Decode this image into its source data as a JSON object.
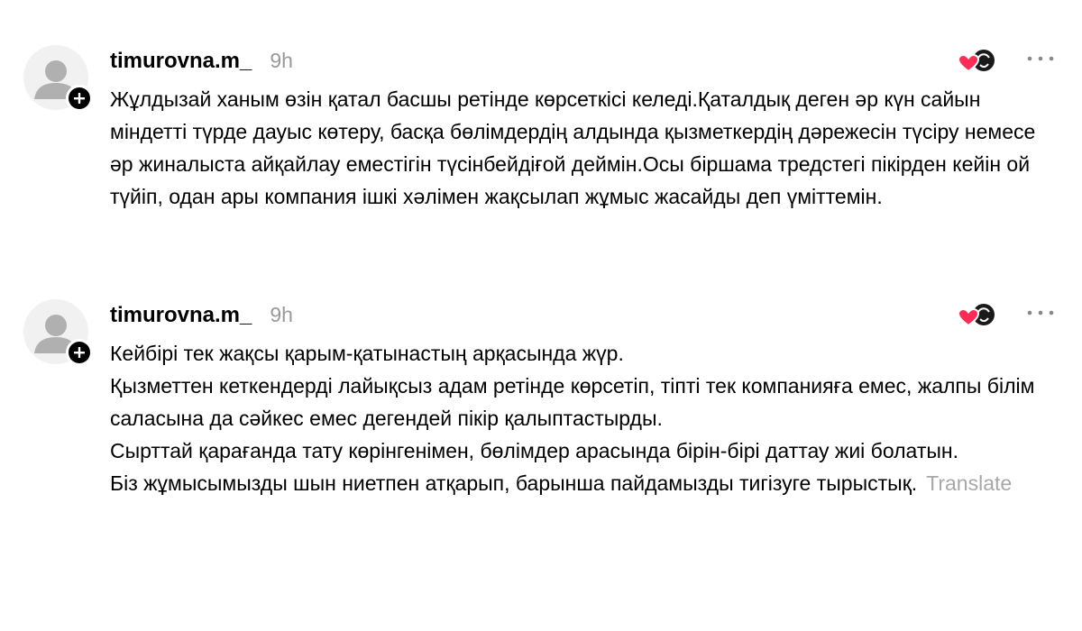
{
  "posts": [
    {
      "username": "timurovna.m_",
      "time": "9h",
      "paragraphs": [
        "Жұлдызай ханым өзін қатал басшы ретінде көрсеткісі келеді.Қаталдық деген әр күн сайын міндетті түрде дауыс көтеру, басқа бөлімдердің алдында қызметкердің дәрежесін түсіру немесе әр жиналыста айқайлау еместігін түсінбейдіғой деймін.Осы біршама тредстегі пікірден кейін ой түйіп, одан ары компания ішкі хәлімен жақсылап жұмыс жасайды деп үміттемін."
      ]
    },
    {
      "username": "timurovna.m_",
      "time": "9h",
      "paragraphs": [
        "Кейбірі тек жақсы қарым-қатынастың арқасында жүр.",
        "Қызметтен кеткендерді лайықсыз адам ретінде көрсетіп, тіпті тек компанияға емес, жалпы білім саласына да сәйкес емес дегендей пікір қалыптастырды.",
        "Сырттай қарағанда тату көрінгенімен, бөлімдер арасында бірін-бірі даттау жиі болатын.",
        "Біз жұмысымызды шын ниетпен атқарып, барынша пайдамызды тигізуге тырыстық."
      ],
      "translate_label": "Translate"
    }
  ],
  "icons": {
    "avatar": "default-avatar-icon",
    "follow": "plus-icon",
    "reactions": "reaction-emojis-icon",
    "more": "more-horizontal-icon"
  },
  "colors": {
    "text": "#000000",
    "muted": "#999999",
    "translate": "#a8a8a8",
    "avatar_bg": "#f1f1f1",
    "avatar_fg": "#b0b0b0",
    "heart": "#ff2d55"
  }
}
